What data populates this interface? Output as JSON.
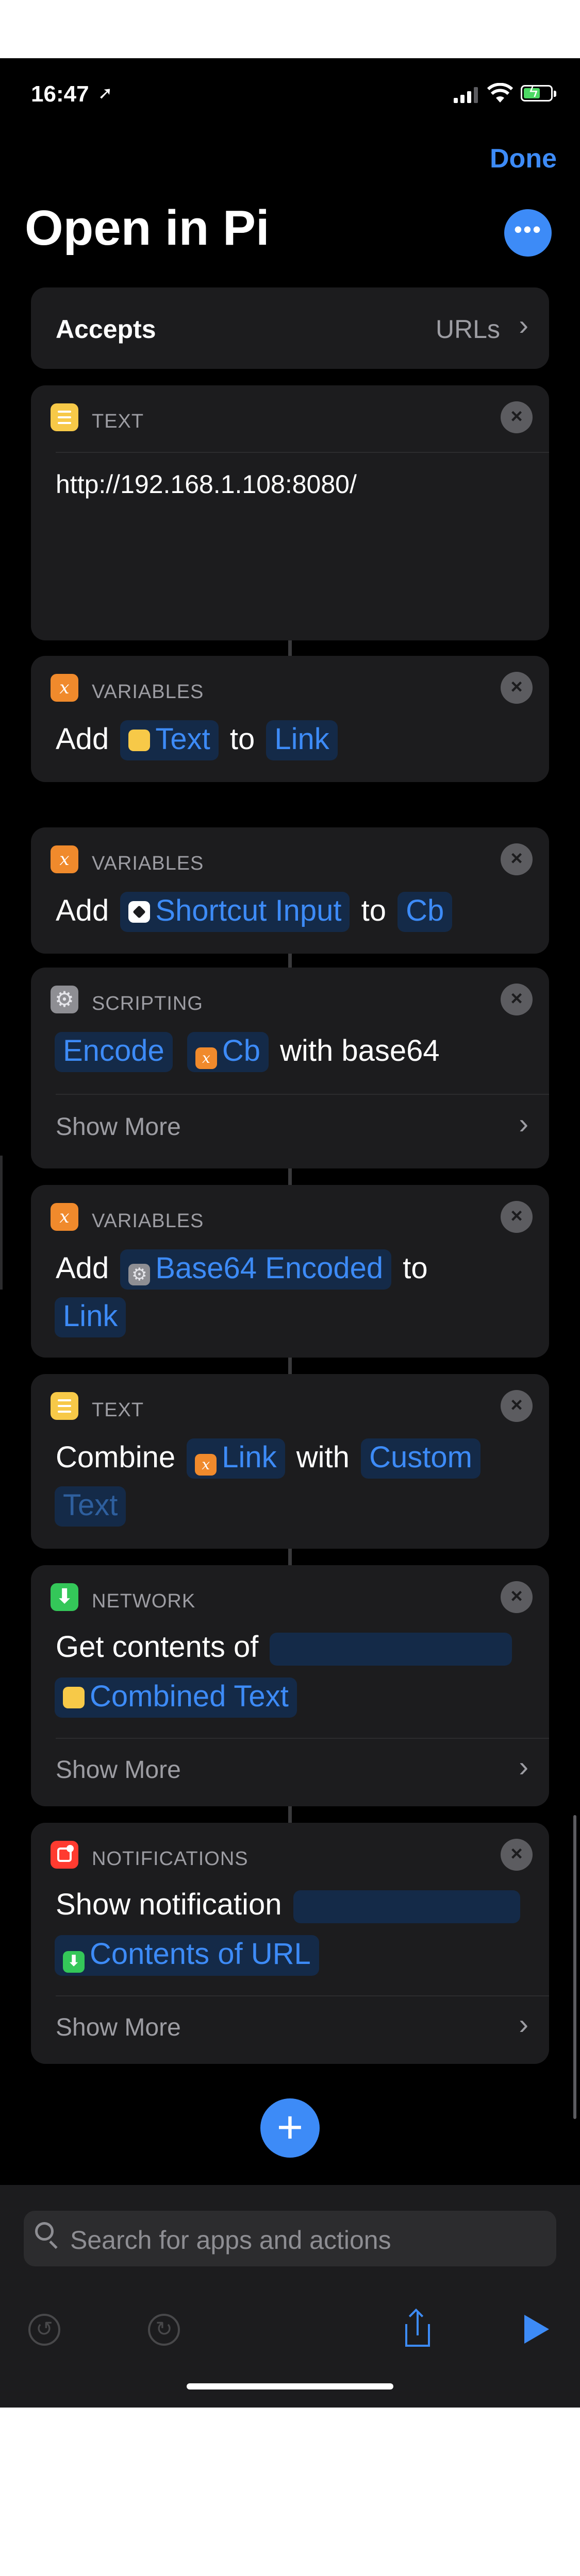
{
  "status_bar": {
    "time": "16:47",
    "location_glyph": "➚"
  },
  "nav": {
    "done_label": "Done",
    "title": "Open in Pi",
    "more_glyph": "•••"
  },
  "accepts": {
    "label": "Accepts",
    "value": "URLs"
  },
  "actions": [
    {
      "category": "TEXT",
      "icon": "text-icon",
      "body": "http://192.168.1.108:8080/"
    },
    {
      "category": "VARIABLES",
      "icon": "variable-icon",
      "verb": "Add",
      "token": "Text",
      "prep": "to",
      "target": "Link"
    },
    {
      "category": "VARIABLES",
      "icon": "variable-icon",
      "verb": "Add",
      "token": "Shortcut Input",
      "prep": "to",
      "target": "Cb"
    },
    {
      "category": "SCRIPTING",
      "icon": "gear-icon",
      "verb": "Encode",
      "token": "Cb",
      "suffix": "with base64",
      "show_more": "Show More"
    },
    {
      "category": "VARIABLES",
      "icon": "variable-icon",
      "verb": "Add",
      "token": "Base64 Encoded",
      "prep": "to",
      "target": "Link"
    },
    {
      "category": "TEXT",
      "icon": "text-icon",
      "verb": "Combine",
      "token": "Link",
      "prep": "with",
      "target_line1": "Custom",
      "target_line2": "Text"
    },
    {
      "category": "NETWORK",
      "icon": "download-icon",
      "verb": "Get contents of",
      "token": "Combined Text",
      "show_more": "Show More"
    },
    {
      "category": "NOTIFICATIONS",
      "icon": "notification-icon",
      "verb": "Show notification",
      "token": "Contents of URL",
      "show_more": "Show More"
    }
  ],
  "icons": {
    "variable_glyph": "x",
    "gear_glyph": "⚙",
    "download_glyph": "⬇",
    "close_glyph": "×",
    "chevron_glyph": "›",
    "plus_glyph": "+",
    "undo_glyph": "↺",
    "redo_glyph": "↻"
  },
  "search": {
    "placeholder": "Search for apps and actions"
  },
  "colors": {
    "accent": "#3d8bf7",
    "background": "#000000",
    "card": "#1c1c1e"
  }
}
